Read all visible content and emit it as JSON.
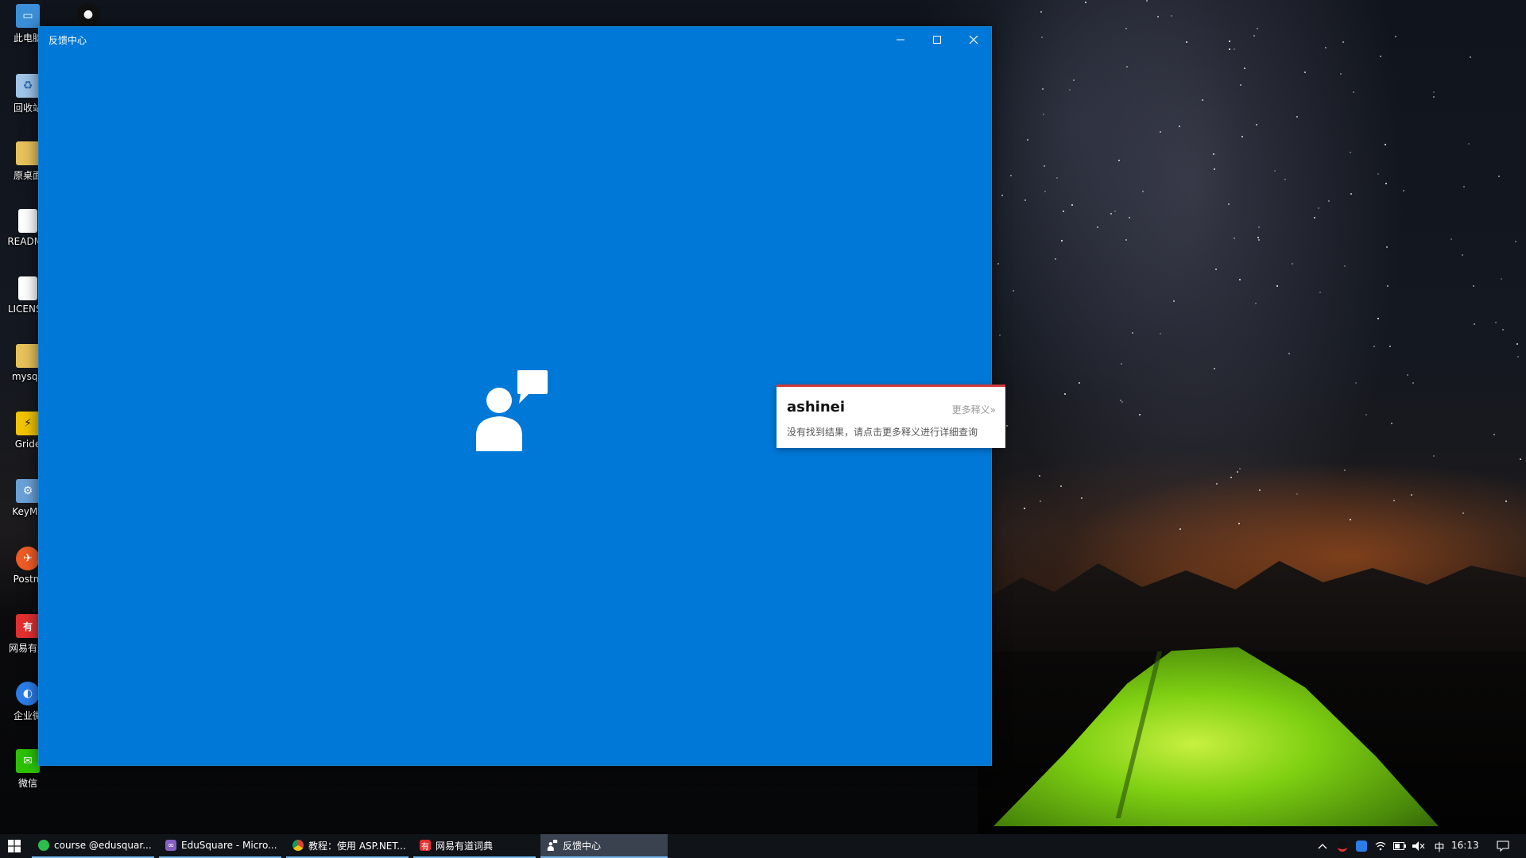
{
  "desktop": {
    "icons": [
      {
        "label": "此电脑",
        "icon": "computer-icon",
        "color": "#3a8fd8"
      },
      {
        "label": "",
        "icon": "qq-icon",
        "color": "#111111"
      },
      {
        "label": "回收站",
        "icon": "recycle-bin-icon",
        "color": "#9fc5e8"
      },
      {
        "label": "原桌面",
        "icon": "folder-icon",
        "color": "#e8c25a"
      },
      {
        "label": "README",
        "icon": "document-icon",
        "color": "#ffffff"
      },
      {
        "label": "LICENSE",
        "icon": "document-icon",
        "color": "#ffffff"
      },
      {
        "label": "mysql-",
        "icon": "folder-icon",
        "color": "#e8c25a"
      },
      {
        "label": "Gride",
        "icon": "app-icon",
        "color": "#f2c400"
      },
      {
        "label": "KeyMa",
        "icon": "app-icon",
        "color": "#6aa2d8"
      },
      {
        "label": "Postm",
        "icon": "postman-icon",
        "color": "#ef5b25"
      },
      {
        "label": "网易有道",
        "icon": "youdao-icon",
        "color": "#e23030"
      },
      {
        "label": "企业微",
        "icon": "wecom-icon",
        "color": "#2b7de9"
      },
      {
        "label": "微信",
        "icon": "wechat-icon",
        "color": "#2dc100"
      }
    ]
  },
  "window": {
    "title": "反馈中心",
    "minimize_glyph": "—",
    "maximize_glyph": "☐",
    "close_glyph": "✕",
    "background": "#0078d7"
  },
  "dictionary_popup": {
    "word": "ashinei",
    "more_link": "更多释义»",
    "message": "没有找到结果，请点击更多释义进行详细查询",
    "accent": "#d33a3a"
  },
  "taskbar": {
    "items": [
      {
        "label": "course @edusquar...",
        "icon": "git-icon",
        "color": "#2dbd4d"
      },
      {
        "label": "EduSquare - Micro...",
        "icon": "visual-studio-icon",
        "color": "#865fc5"
      },
      {
        "label": "教程：使用 ASP.NET...",
        "icon": "chrome-icon",
        "color": "#e0b020"
      },
      {
        "label": "网易有道词典",
        "icon": "youdao-icon",
        "color": "#e23030"
      },
      {
        "label": "反馈中心",
        "icon": "feedback-hub-icon",
        "color": "#5a6a80"
      }
    ],
    "tray": {
      "ime": "中",
      "time": "16:13"
    }
  }
}
